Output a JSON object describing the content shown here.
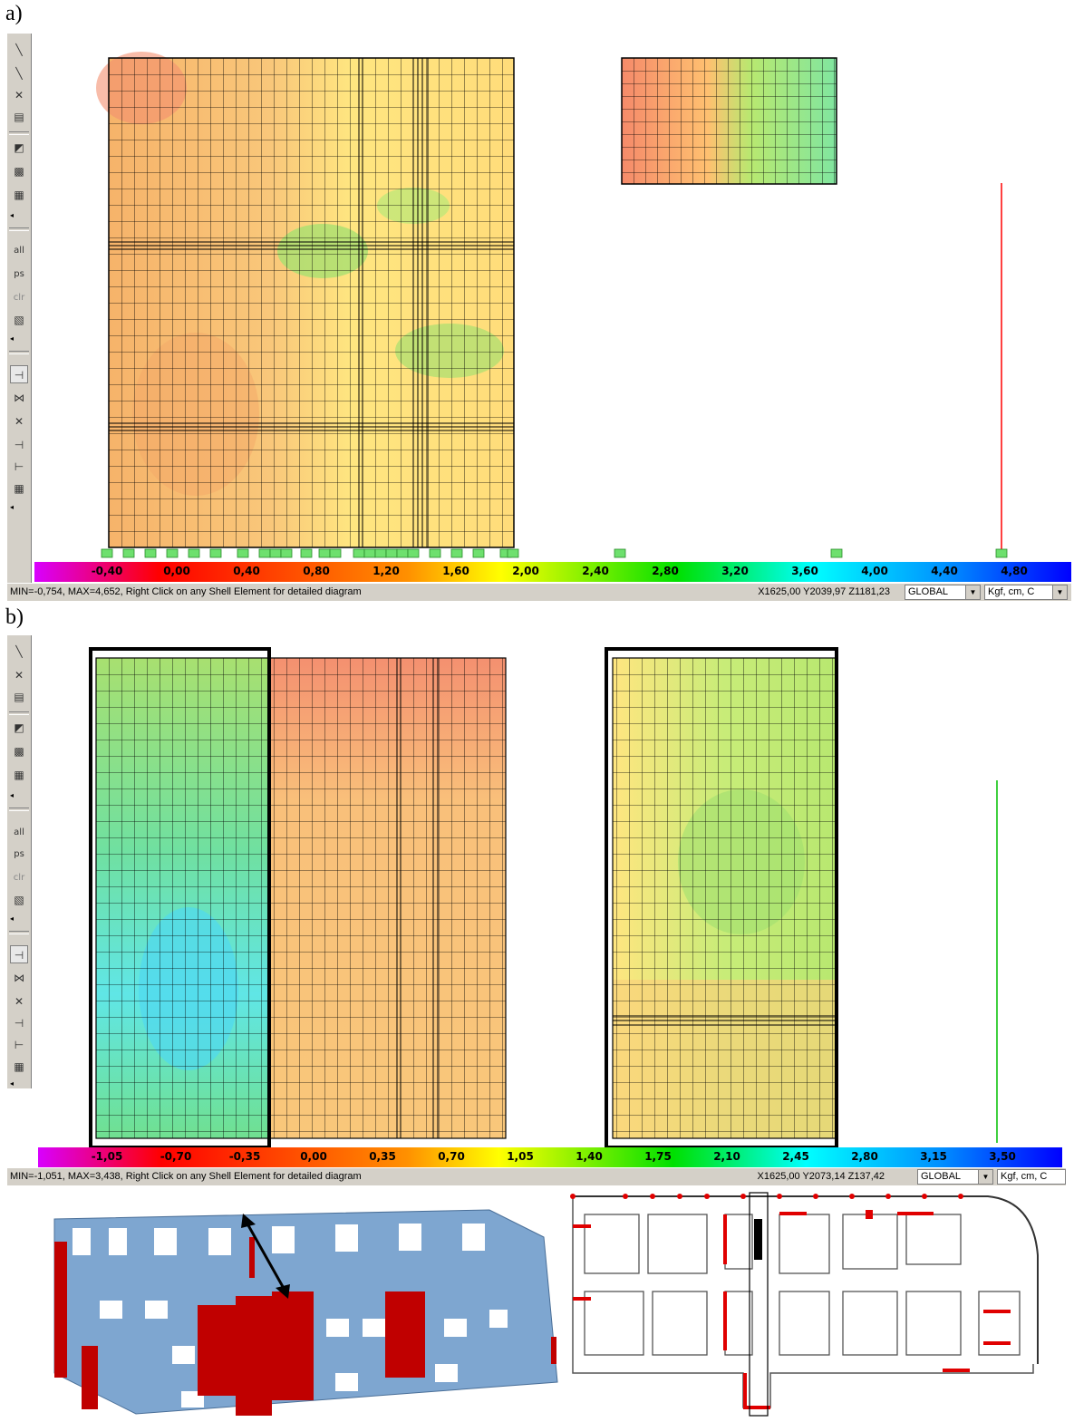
{
  "panels": [
    {
      "label": "a)",
      "legend_values": [
        "-0,40",
        "0,00",
        "0,40",
        "0,80",
        "1,20",
        "1,60",
        "2,00",
        "2,40",
        "2,80",
        "3,20",
        "3,60",
        "4,00",
        "4,40",
        "4,80"
      ],
      "status_msg": "MIN=-0,754, MAX=4,652, Right Click on any Shell Element for detailed diagram",
      "coords": "X1625,00  Y2039,97  Z1181,23",
      "cs": "GLOBAL",
      "units": "Kgf, cm, C"
    },
    {
      "label": "b)",
      "legend_values": [
        "-1,05",
        "-0,70",
        "-0,35",
        "0,00",
        "0,35",
        "0,70",
        "1,05",
        "1,40",
        "1,75",
        "2,10",
        "2,45",
        "2,80",
        "3,15",
        "3,50"
      ],
      "status_msg": "MIN=-1,051, MAX=3,438, Right Click on any Shell Element for detailed diagram",
      "coords": "X1625,00  Y2073,14  Z137,42",
      "cs": "GLOBAL",
      "units": "Kgf, cm, C"
    }
  ],
  "toolbar_glyphs": {
    "all": "all",
    "ps": "ps",
    "clr": "clr"
  },
  "colors": {
    "wall_3d": "#7ea6d0",
    "wall_highlight": "#c00000",
    "contour_orange": "#f6b36a",
    "contour_yellow": "#ffe680",
    "contour_green": "#8fe070"
  }
}
